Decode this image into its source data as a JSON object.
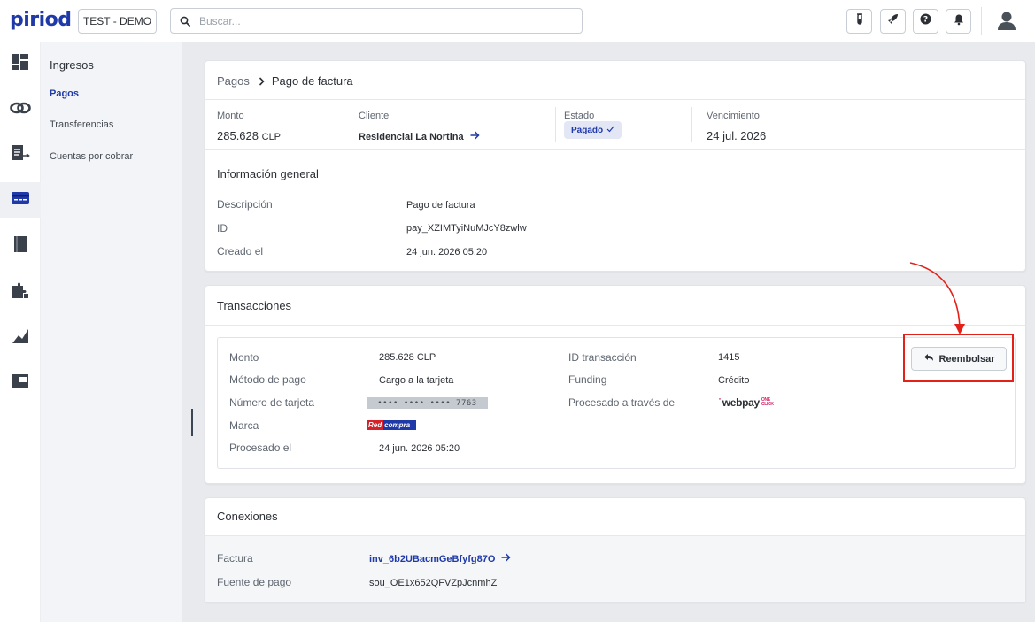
{
  "header": {
    "logo": "piriod",
    "environment": "TEST - DEMO",
    "search_placeholder": "Buscar...",
    "icons": [
      "test-tube-icon",
      "rocket-icon",
      "help-icon",
      "bell-icon",
      "user-avatar-icon"
    ]
  },
  "rail": {
    "items": [
      "dashboard-icon",
      "link-icon",
      "invoice-icon",
      "card-icon",
      "book-icon",
      "puzzle-icon",
      "chart-icon",
      "window-icon"
    ],
    "active": "card-icon"
  },
  "subnav": {
    "title": "Ingresos",
    "items": [
      {
        "label": "Pagos",
        "active": true
      },
      {
        "label": "Transferencias",
        "active": false
      },
      {
        "label": "Cuentas por cobrar",
        "active": false
      }
    ]
  },
  "breadcrumb": {
    "root": "Pagos",
    "current": "Pago de factura"
  },
  "summary": {
    "amount": {
      "label": "Monto",
      "value": "285.628",
      "currency": "CLP"
    },
    "customer": {
      "label": "Cliente",
      "value": "Residencial La Nortina"
    },
    "status": {
      "label": "Estado",
      "value": "Pagado"
    },
    "due": {
      "label": "Vencimiento",
      "value": "24 jul. 2026"
    }
  },
  "general": {
    "title": "Información general",
    "rows": [
      {
        "label": "Descripción",
        "value": "Pago de factura"
      },
      {
        "label": "ID",
        "value": "pay_XZIMTyiNuMJcY8zwlw"
      },
      {
        "label": "Creado el",
        "value": "24 jun. 2026 05:20"
      }
    ]
  },
  "transactions": {
    "title": "Transacciones",
    "left": [
      {
        "label": "Monto",
        "value": "285.628 CLP"
      },
      {
        "label": "Método de pago",
        "value": "Cargo a la tarjeta"
      },
      {
        "label": "Número de tarjeta",
        "value": "•••• •••• •••• 7763"
      },
      {
        "label": "Marca",
        "value": "Redcompra",
        "brand_part1": "Red",
        "brand_part2": "compra"
      },
      {
        "label": "Procesado el",
        "value": "24 jun. 2026 05:20"
      }
    ],
    "right": [
      {
        "label": "ID transacción",
        "value": "1415"
      },
      {
        "label": "Funding",
        "value": "Crédito"
      },
      {
        "label": "Procesado a través de",
        "value": "webpay",
        "logo_suffix": "ONE CLICK"
      }
    ],
    "refund_button": "Reembolsar"
  },
  "connections": {
    "title": "Conexiones",
    "rows": [
      {
        "label": "Factura",
        "value": "inv_6b2UBacmGeBfyfg87O"
      },
      {
        "label": "Fuente de pago",
        "value": "sou_OE1x652QFVZpJcnmhZ"
      }
    ]
  },
  "colors": {
    "brand": "#1f3aa8",
    "annotation": "#e32119",
    "background": "#e8eaee"
  }
}
